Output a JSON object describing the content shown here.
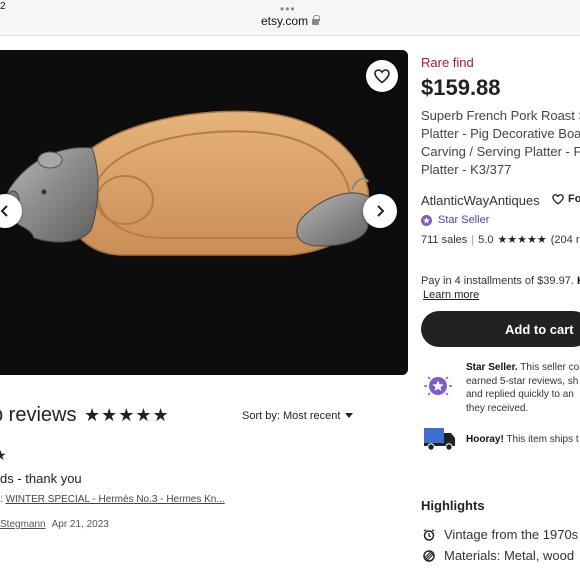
{
  "browser": {
    "clock": "2",
    "dots": "•••",
    "url": "etsy.com"
  },
  "gallery": {
    "favorite_icon": "heart-icon",
    "prev_icon": "chevron-left-icon",
    "next_icon": "chevron-right-icon"
  },
  "listing": {
    "rare_label": "Rare find",
    "price": "$159.88",
    "title_lines": [
      "Superb French Pork Roast S",
      "Platter - Pig Decorative Boar",
      "Carving / Serving Platter - F",
      "Platter - K3/377"
    ],
    "shop_name": "AtlanticWayAntiques",
    "follow_label": "Fo",
    "star_seller_label": "Star Seller",
    "sales": "711 sales",
    "rating": "5.0",
    "rating_stars": "★★★★★",
    "rating_count": "(204 r",
    "installments_text": "Pay in 4 installments of $39.97.",
    "installments_provider": "Kl",
    "learn_more": "Learn more",
    "add_to_cart": "Add to cart"
  },
  "perks": {
    "star_seller_bold": "Star Seller.",
    "star_seller_lines": [
      " This seller co",
      "earned 5-star reviews, sh",
      "and replied quickly to an",
      "they received."
    ],
    "hooray_bold": "Hooray!",
    "hooray_text": " This item ships t"
  },
  "highlights": {
    "heading": "Highlights",
    "items": [
      {
        "icon": "vintage-clock-icon",
        "text": "Vintage from the 1970s"
      },
      {
        "icon": "materials-icon",
        "text": "Materials: Metal, wood"
      }
    ]
  },
  "reviews": {
    "heading": "b reviews",
    "heading_stars": "★★★★★",
    "sort_label": "Sort by: Most recent",
    "review_star": "★",
    "review_text": "ds - thank you",
    "item_prefix": ": ",
    "item_link": "WINTER SPECIAL - Hermès No.3 - Hermes Kn...",
    "author": "Stegmann",
    "date": "Apr 21, 2023"
  },
  "colors": {
    "rare": "#a61a2e",
    "star_seller": "#5b3fa3",
    "cart_button": "#222222",
    "photo_bg": "#0d0d0d",
    "board_wood": "#d9a066"
  }
}
